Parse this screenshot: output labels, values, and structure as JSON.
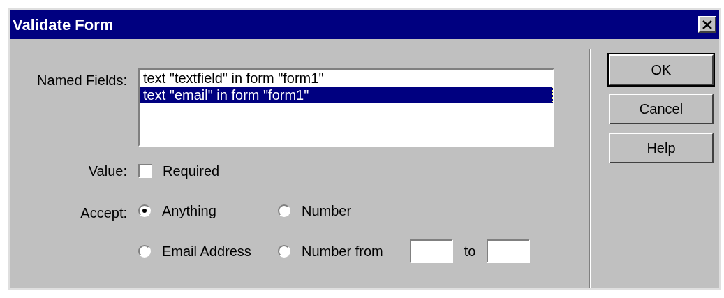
{
  "window": {
    "title": "Validate Form"
  },
  "named_fields": {
    "label": "Named Fields:",
    "items": [
      {
        "text": "text \"textfield\" in form \"form1\"",
        "selected": false
      },
      {
        "text": "text \"email\" in form \"form1\"",
        "selected": true
      }
    ]
  },
  "value": {
    "label": "Value:",
    "checkbox": {
      "label": "Required",
      "checked": false
    }
  },
  "accept": {
    "label": "Accept:",
    "options": [
      {
        "kind": "plain",
        "label": "Anything",
        "selected": true
      },
      {
        "kind": "plain",
        "label": "Number",
        "selected": false
      },
      {
        "kind": "plain",
        "label": "Email Address",
        "selected": false
      },
      {
        "kind": "range",
        "label": "Number from",
        "selected": false,
        "separator": "to"
      }
    ]
  },
  "buttons": [
    {
      "label": "OK",
      "default": true
    },
    {
      "label": "Cancel",
      "default": false
    },
    {
      "label": "Help",
      "default": false
    }
  ]
}
